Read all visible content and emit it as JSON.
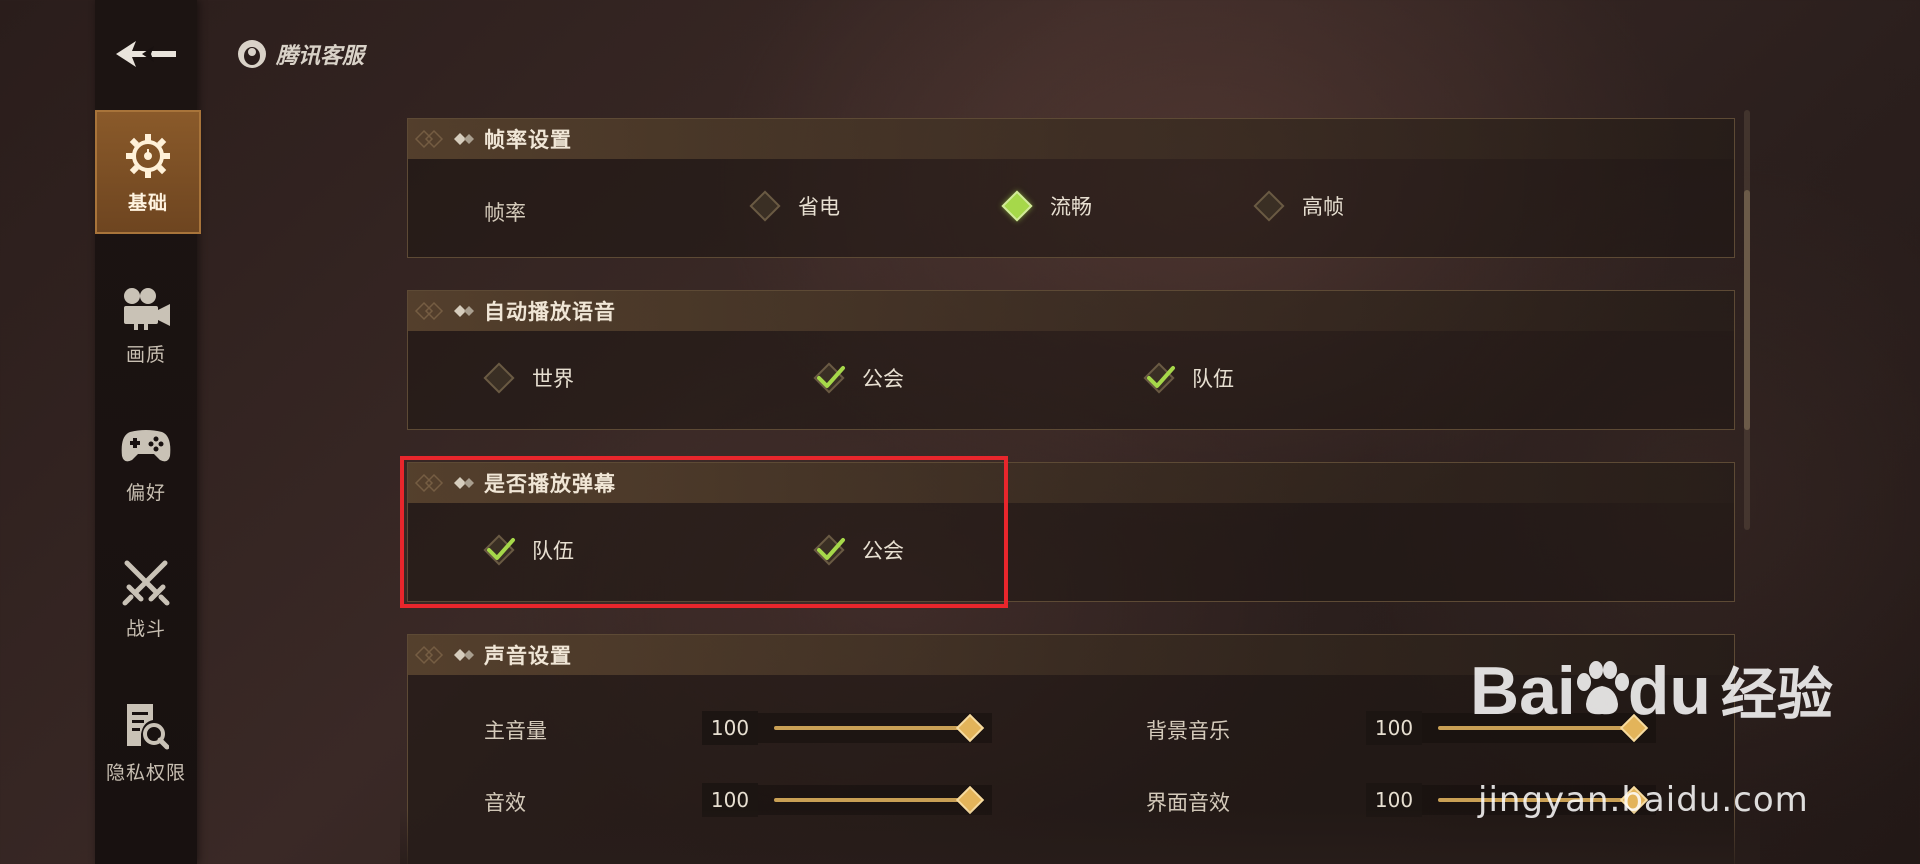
{
  "brand": {
    "name": "腾讯客服"
  },
  "sidebar": {
    "items": [
      {
        "label": "基础",
        "icon": "gear-icon",
        "active": true
      },
      {
        "label": "画质",
        "icon": "camera-icon",
        "active": false
      },
      {
        "label": "偏好",
        "icon": "gamepad-icon",
        "active": false
      },
      {
        "label": "战斗",
        "icon": "crossed-swords-icon",
        "active": false
      },
      {
        "label": "隐私权限",
        "icon": "privacy-search-icon",
        "active": false
      }
    ]
  },
  "sections": {
    "frame_rate": {
      "title": "帧率设置",
      "row_label": "帧率",
      "options": [
        {
          "label": "省电",
          "selected": false
        },
        {
          "label": "流畅",
          "selected": true
        },
        {
          "label": "高帧",
          "selected": false
        }
      ]
    },
    "auto_voice": {
      "title": "自动播放语音",
      "options": [
        {
          "label": "世界",
          "checked": false
        },
        {
          "label": "公会",
          "checked": true
        },
        {
          "label": "队伍",
          "checked": true
        }
      ]
    },
    "danmaku": {
      "title": "是否播放弹幕",
      "options": [
        {
          "label": "队伍",
          "checked": true
        },
        {
          "label": "公会",
          "checked": true
        }
      ]
    },
    "sound": {
      "title": "声音设置",
      "sliders": [
        {
          "label": "主音量",
          "value": "100",
          "level": 1.0
        },
        {
          "label": "背景音乐",
          "value": "100",
          "level": 1.0
        },
        {
          "label": "音效",
          "value": "100",
          "level": 1.0
        },
        {
          "label": "界面音效",
          "value": "100",
          "level": 1.0
        }
      ]
    }
  },
  "watermark": {
    "brand": "Bai",
    "brand_tail": "du",
    "cn": "经验",
    "url": "jingyan.baidu.com"
  },
  "colors": {
    "accent": "#a6d84a",
    "gold": "#c9a055",
    "highlight": "#e8262c",
    "active_tab": "#8a5a2a"
  }
}
